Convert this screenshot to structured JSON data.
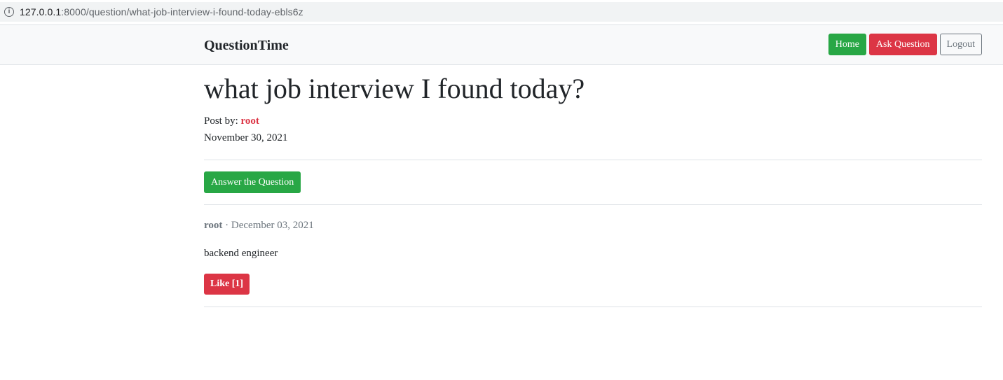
{
  "browser": {
    "url_host": "127.0.0.1",
    "url_path": ":8000/question/what-job-interview-i-found-today-ebls6z"
  },
  "navbar": {
    "brand": "QuestionTime",
    "home_label": "Home",
    "ask_label": "Ask Question",
    "logout_label": "Logout"
  },
  "question": {
    "title": "what job interview I found today?",
    "post_by_label": "Post by:",
    "author": "root",
    "date": "November 30, 2021",
    "answer_button_label": "Answer the Question"
  },
  "answers": [
    {
      "author": "root",
      "separator": "·",
      "date": "December 03, 2021",
      "body": "backend engineer",
      "like_label": "Like [1]"
    }
  ],
  "colors": {
    "success": "#28a745",
    "danger": "#dc3545",
    "secondary": "#6c757d"
  }
}
